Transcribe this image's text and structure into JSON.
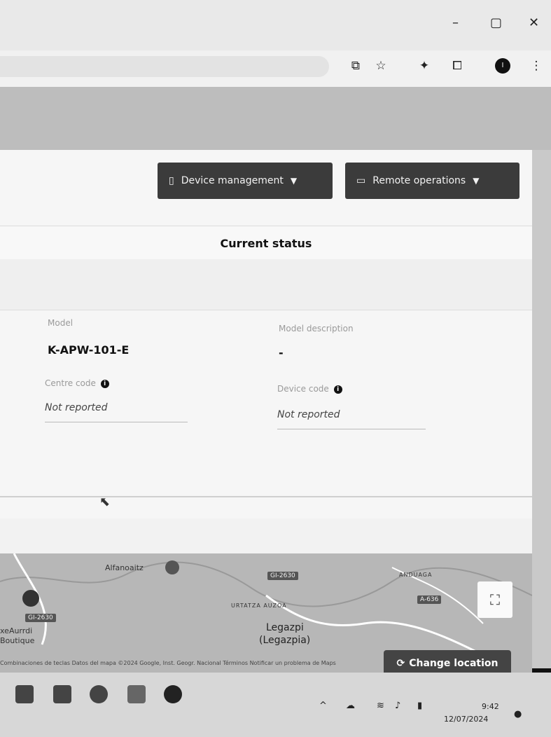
{
  "window": {
    "minimize": "–",
    "restore": "▢",
    "close": "✕"
  },
  "toolbar_icons": [
    "install-icon",
    "star-icon",
    "extensions-icon",
    "puzzle-icon",
    "profile-icon",
    "menu-icon"
  ],
  "profile_initial": "I",
  "actions": {
    "device_management": "Device management",
    "remote_operations": "Remote operations"
  },
  "status": {
    "title": "Current status"
  },
  "fields": {
    "model_label": "Model",
    "model_value": "K-APW-101-E",
    "model_description_label": "Model description",
    "model_description_value": "-",
    "centre_code_label": "Centre code",
    "centre_code_value": "Not reported",
    "device_code_label": "Device code",
    "device_code_value": "Not reported"
  },
  "map": {
    "place_1": "Alfanoaitz",
    "place_2": "URTATZA AUZOA",
    "place_3": "Legazpi",
    "place_4": "(Legazpia)",
    "place_5": "ANDUAGA",
    "place_6": "xeAurrdi",
    "place_7": "Boutique",
    "road_1": "GI-2630",
    "road_2": "GI-2630",
    "road_3": "A-636",
    "change_location": "Change location",
    "footer": "Combinaciones de teclas   Datos del mapa ©2024 Google, Inst. Geogr. Nacional   Términos   Notificar un problema de Maps"
  },
  "taskbar": {
    "time": "9:42",
    "date": "12/07/2024"
  }
}
